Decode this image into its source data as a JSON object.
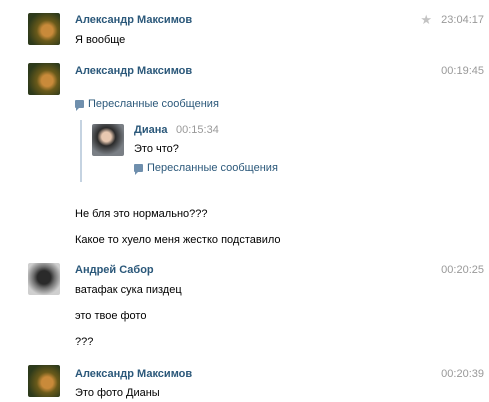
{
  "messages": [
    {
      "author": "Александр Максимов",
      "time": "23:04:17",
      "starred": true,
      "lines": [
        "Я вообще"
      ]
    },
    {
      "author": "Александр Максимов",
      "time": "00:19:45",
      "forwarded_label": "Пересланные сообщения",
      "forwarded": {
        "author": "Диана",
        "time": "00:15:34",
        "text": "Это что?",
        "forwarded_label": "Пересланные сообщения"
      },
      "lines": [
        "Не бля это нормально???",
        "Какое то хуело меня жестко подставило"
      ]
    },
    {
      "author": "Андрей Сабор",
      "time": "00:20:25",
      "lines": [
        "ватафак сука пиздец",
        "это твое фото",
        "???"
      ]
    },
    {
      "author": "Александр Максимов",
      "time": "00:20:39",
      "lines": [
        "Это фото Дианы"
      ]
    }
  ],
  "icons": {
    "star": "star-icon",
    "forward": "forwarded-messages-icon"
  },
  "colors": {
    "author": "#2b587a",
    "time": "#999999",
    "forward_border": "#c5d3e1"
  }
}
